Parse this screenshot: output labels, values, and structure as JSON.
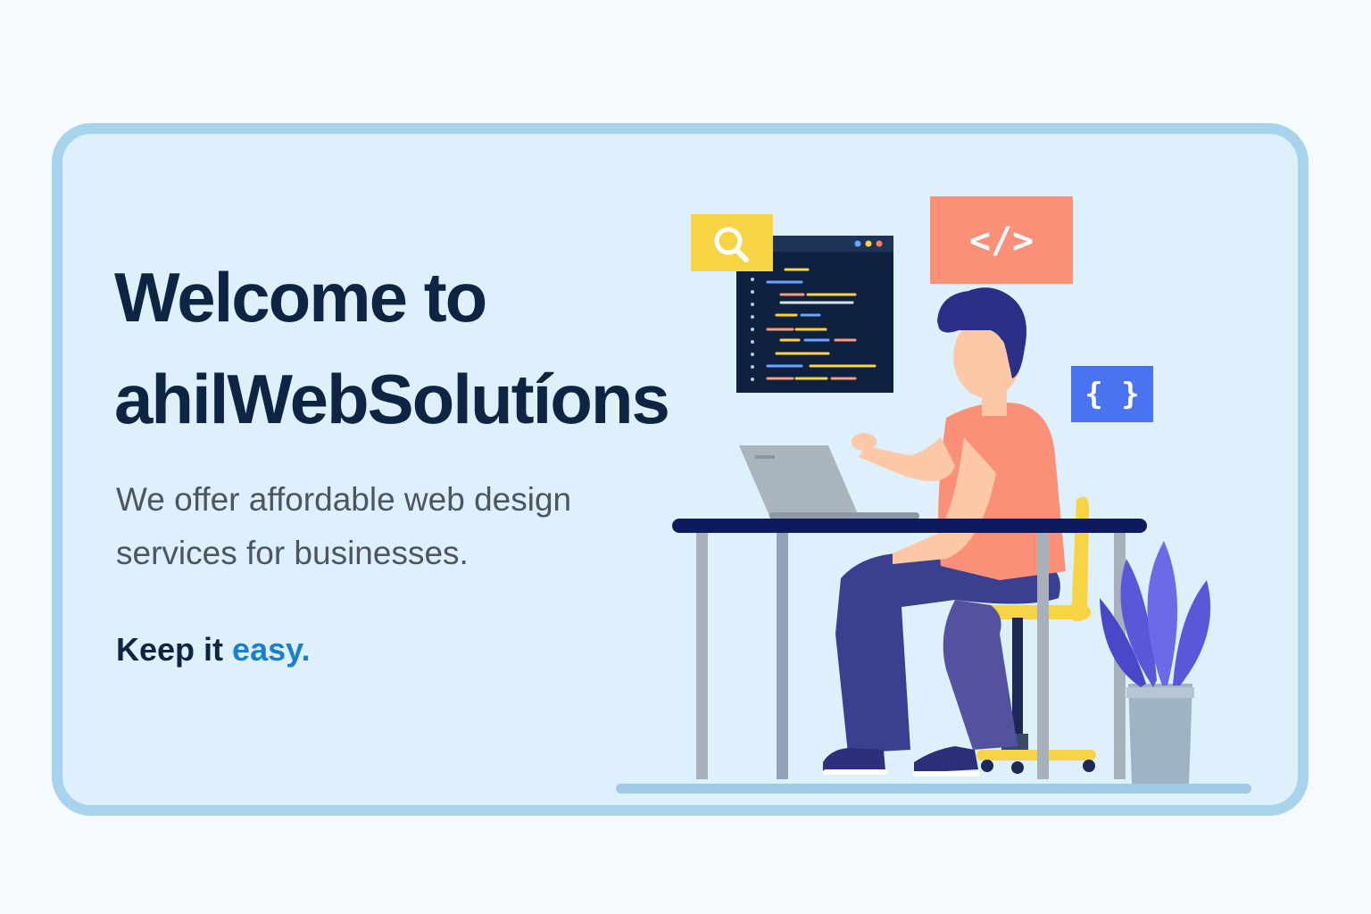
{
  "hero": {
    "title_line1": "Welcome to",
    "title_line2": "ahilWebSolutíons",
    "tagline": "We offer affordable web design services for businesses.",
    "motto_prefix": "Keep it",
    "motto_accent": "easy."
  },
  "illustration": {
    "code_tag_text": "</>",
    "braces_text": "{ }",
    "icons": [
      "search-icon",
      "code-tag-icon",
      "braces-icon",
      "code-window-icon",
      "laptop-icon",
      "plant-icon"
    ]
  },
  "colors": {
    "page_background": "#f4fafd",
    "card_background": "#def0fc",
    "card_border": "#a8d3ec",
    "title": "#0d2442",
    "body_text": "#4c5560",
    "accent": "#1a7fd0",
    "search_tile": "#f7d443",
    "code_tag_tile": "#fb9079",
    "braces_tile": "#4a73ef",
    "code_window": "#0e2240",
    "shirt": "#fb9079",
    "pants": "#3a3f90",
    "chair": "#f7d443",
    "desk": "#0d1b5e",
    "plant": "#5a58d9"
  }
}
